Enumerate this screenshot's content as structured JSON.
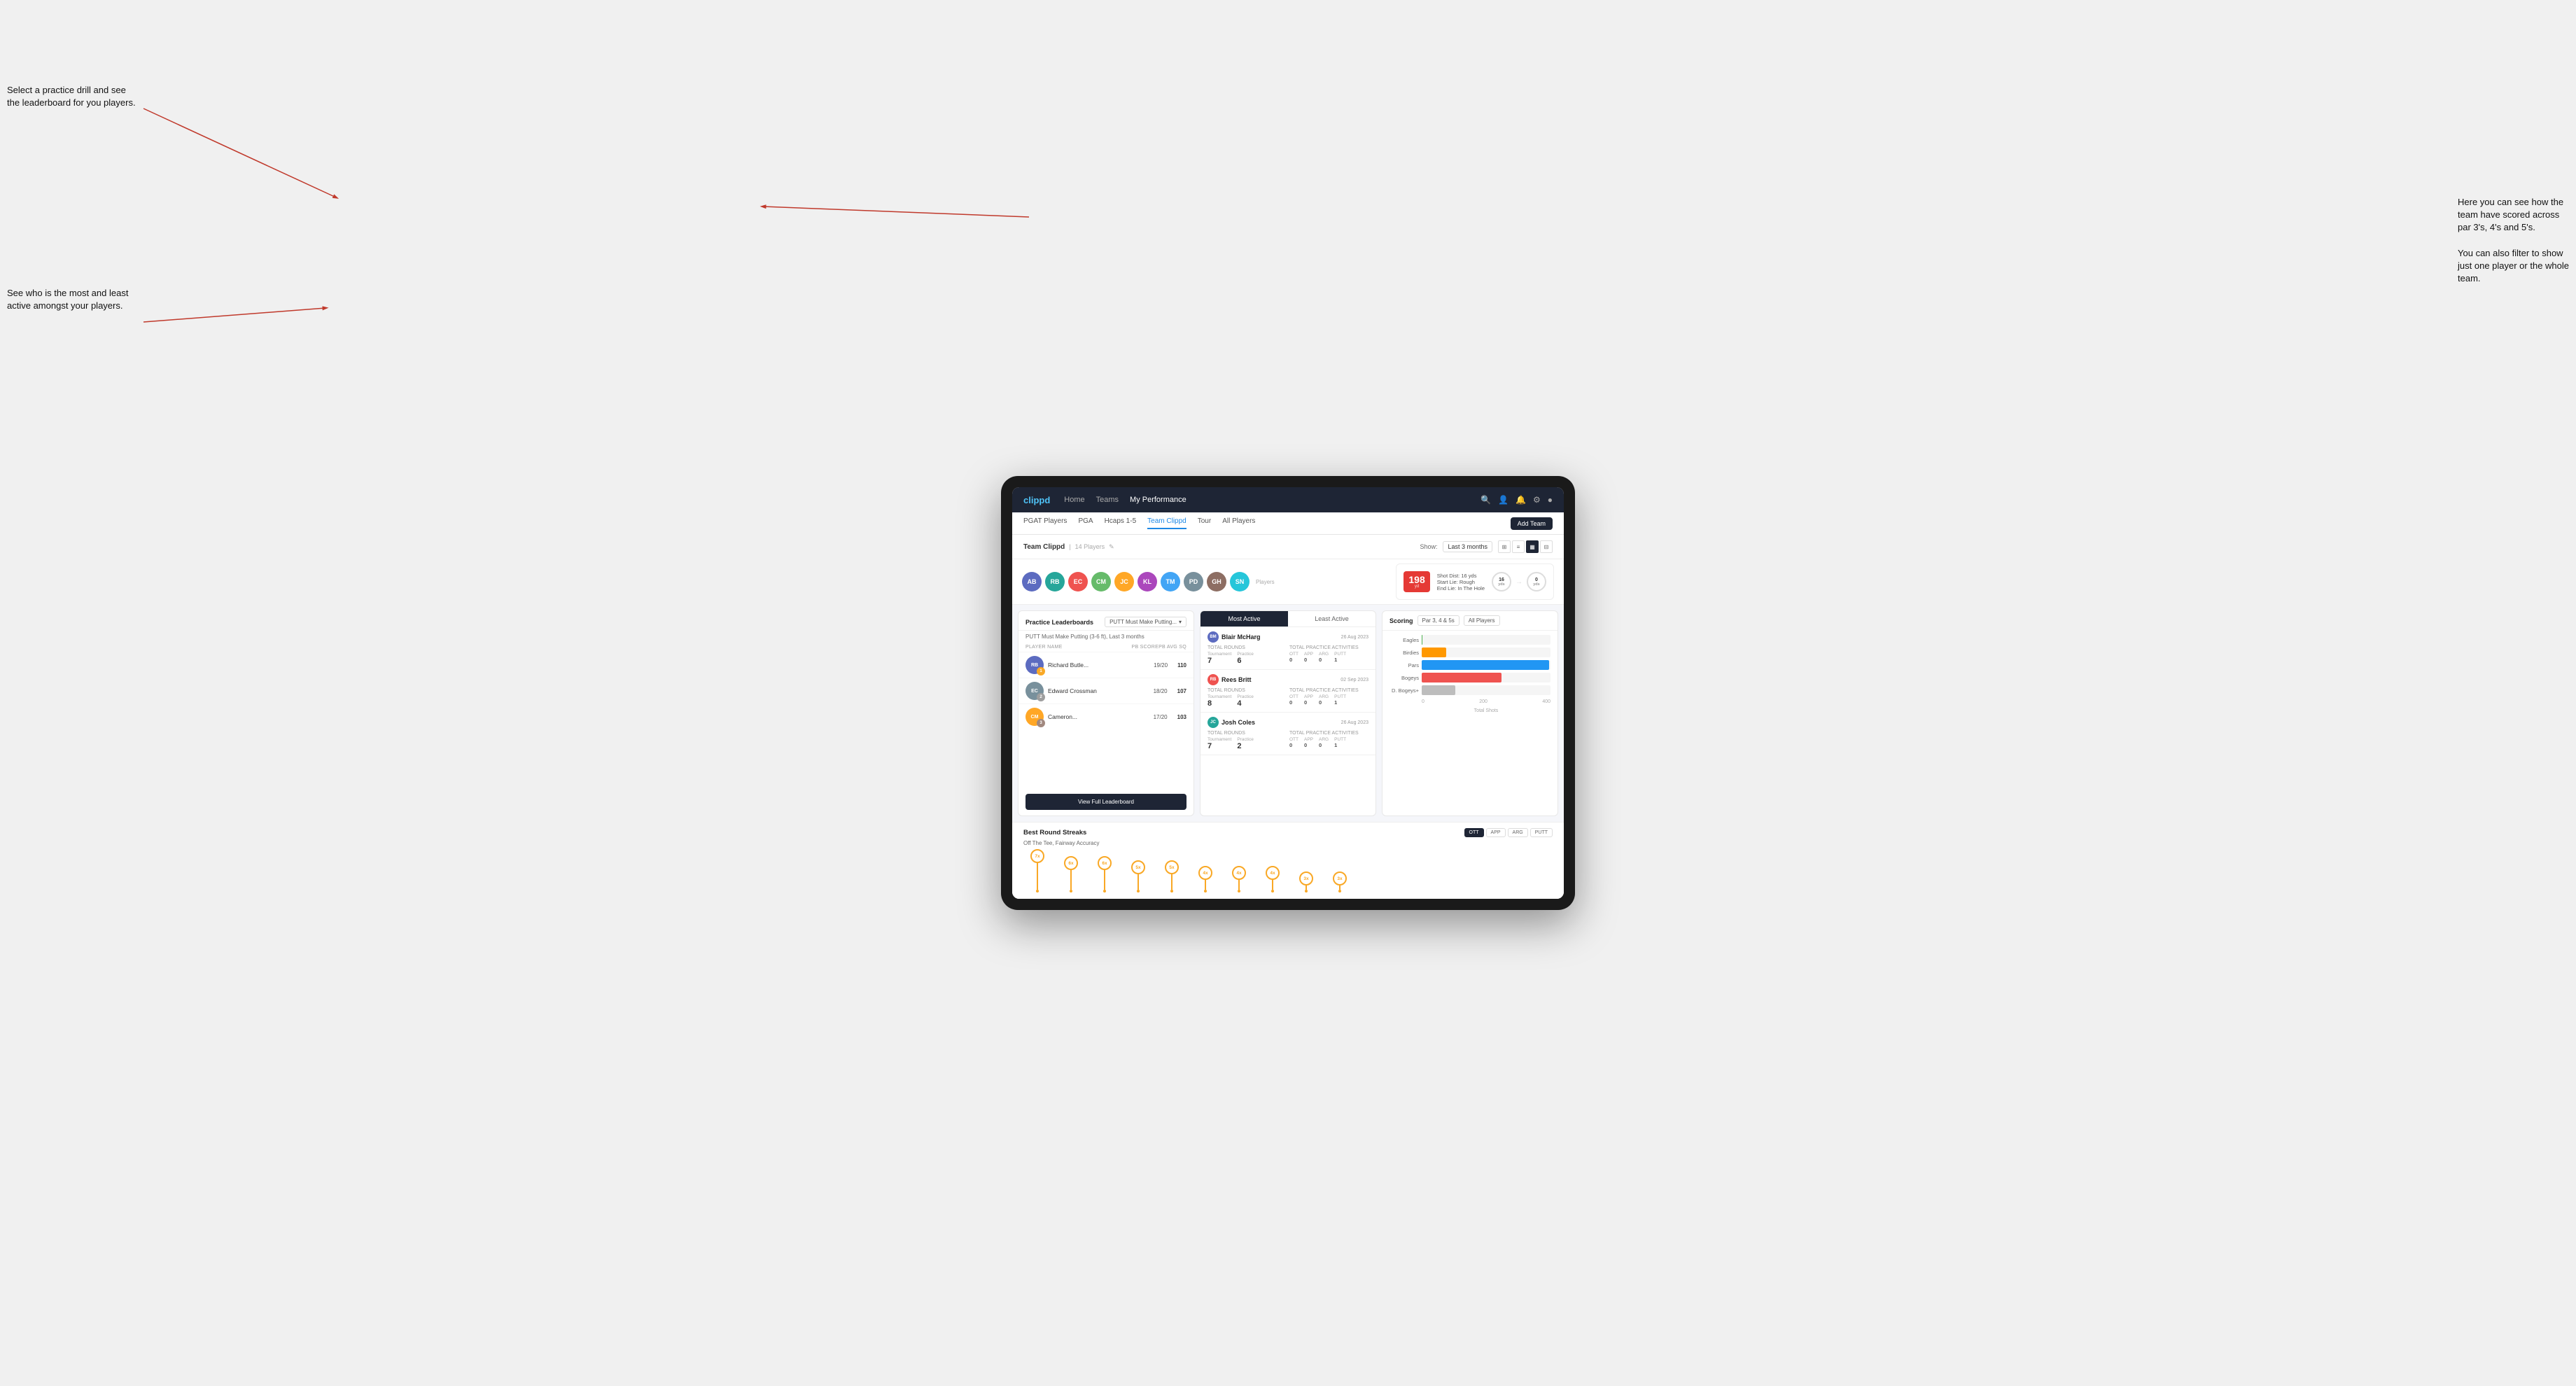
{
  "annotations": {
    "top_left": "Select a practice drill and see\nthe leaderboard for you players.",
    "bottom_left": "See who is the most and least\nactive amongst your players.",
    "top_right_line1": "Here you can see how the",
    "top_right_line2": "team have scored across",
    "top_right_line3": "par 3's, 4's and 5's.",
    "top_right_line4": "",
    "top_right_line5": "You can also filter to show",
    "top_right_line6": "just one player or the whole",
    "top_right_line7": "team."
  },
  "navbar": {
    "logo": "clippd",
    "links": [
      "Home",
      "Teams",
      "My Performance"
    ],
    "active_link": "My Performance"
  },
  "subnav": {
    "links": [
      "PGAT Players",
      "PGA",
      "Hcaps 1-5",
      "Team Clippd",
      "Tour",
      "All Players"
    ],
    "active_link": "Team Clippd",
    "add_team_label": "Add Team"
  },
  "team_header": {
    "title": "Team Clippd",
    "count": "14 Players",
    "show_label": "Show:",
    "period": "Last 3 months"
  },
  "shot_info": {
    "distance": "198",
    "unit": "yd",
    "start_lie": "Start Lie: Rough",
    "end_lie": "End Lie: In The Hole",
    "shot_dist": "Shot Dist: 16 yds",
    "yds1": "16",
    "yds2": "0",
    "yds_label": "yds"
  },
  "practice_leaderboard": {
    "title": "Practice Leaderboards",
    "drill": "PUTT Must Make Putting...",
    "subtitle": "PUTT Must Make Putting (3-6 ft), Last 3 months",
    "headers": [
      "PLAYER NAME",
      "PB SCORE",
      "PB AVG SQ"
    ],
    "rows": [
      {
        "name": "Richard Butle...",
        "score": "19/20",
        "avg": "110",
        "rank": 1,
        "badge": "gold",
        "initials": "RB"
      },
      {
        "name": "Edward Crossman",
        "score": "18/20",
        "avg": "107",
        "rank": 2,
        "badge": "silver",
        "initials": "EC"
      },
      {
        "name": "Cameron...",
        "score": "17/20",
        "avg": "103",
        "rank": 3,
        "badge": "bronze",
        "initials": "CM"
      }
    ],
    "view_full_label": "View Full Leaderboard"
  },
  "activity": {
    "tabs": [
      "Most Active",
      "Least Active"
    ],
    "active_tab": "Most Active",
    "players": [
      {
        "name": "Blair McHarg",
        "date": "26 Aug 2023",
        "total_rounds_label": "Total Rounds",
        "tournament": "7",
        "tournament_label": "Tournament",
        "practice": "6",
        "practice_label": "Practice",
        "total_practice_label": "Total Practice Activities",
        "ott": "0",
        "app": "0",
        "arg": "0",
        "putt": "1",
        "initials": "BM",
        "color": "#5c6bc0"
      },
      {
        "name": "Rees Britt",
        "date": "02 Sep 2023",
        "total_rounds_label": "Total Rounds",
        "tournament": "8",
        "tournament_label": "Tournament",
        "practice": "4",
        "practice_label": "Practice",
        "total_practice_label": "Total Practice Activities",
        "ott": "0",
        "app": "0",
        "arg": "0",
        "putt": "1",
        "initials": "RB",
        "color": "#ef5350"
      },
      {
        "name": "Josh Coles",
        "date": "26 Aug 2023",
        "total_rounds_label": "Total Rounds",
        "tournament": "7",
        "tournament_label": "Tournament",
        "practice": "2",
        "practice_label": "Practice",
        "total_practice_label": "Total Practice Activities",
        "ott": "0",
        "app": "0",
        "arg": "0",
        "putt": "1",
        "initials": "JC",
        "color": "#26a69a"
      }
    ]
  },
  "scoring": {
    "title": "Scoring",
    "filter1": "Par 3, 4 & 5s",
    "filter2": "All Players",
    "bars": [
      {
        "label": "Eagles",
        "value": 3,
        "max": 400,
        "pct": 0.75,
        "color": "#4caf50"
      },
      {
        "label": "Birdies",
        "value": 96,
        "max": 400,
        "pct": 24,
        "color": "#ff9800"
      },
      {
        "label": "Pars",
        "value": 499,
        "max": 500,
        "pct": 99.8,
        "color": "#2196f3"
      },
      {
        "label": "Bogeys",
        "value": 311,
        "max": 500,
        "pct": 62.2,
        "color": "#ef5350"
      },
      {
        "label": "D. Bogeys+",
        "value": 131,
        "max": 500,
        "pct": 26.2,
        "color": "#bdbdbd"
      }
    ],
    "axis_labels": [
      "0",
      "200",
      "400"
    ],
    "axis_title": "Total Shots"
  },
  "streaks": {
    "title": "Best Round Streaks",
    "subtitle": "Off The Tee, Fairway Accuracy",
    "buttons": [
      "OTT",
      "APP",
      "ARG",
      "PUTT"
    ],
    "active_btn": "OTT",
    "pins": [
      {
        "label": "7x",
        "height": 55
      },
      {
        "label": "6x",
        "height": 44
      },
      {
        "label": "6x",
        "height": 44
      },
      {
        "label": "5x",
        "height": 36
      },
      {
        "label": "5x",
        "height": 36
      },
      {
        "label": "4x",
        "height": 28
      },
      {
        "label": "4x",
        "height": 28
      },
      {
        "label": "4x",
        "height": 28
      },
      {
        "label": "3x",
        "height": 20
      },
      {
        "label": "3x",
        "height": 20
      }
    ]
  },
  "players": [
    {
      "initials": "AB",
      "color": "#5c6bc0"
    },
    {
      "initials": "RB",
      "color": "#ef5350"
    },
    {
      "initials": "EC",
      "color": "#26a69a"
    },
    {
      "initials": "CM",
      "color": "#ffa726"
    },
    {
      "initials": "JC",
      "color": "#42a5f5"
    },
    {
      "initials": "KL",
      "color": "#ab47bc"
    },
    {
      "initials": "TM",
      "color": "#66bb6a"
    },
    {
      "initials": "PD",
      "color": "#78909c"
    },
    {
      "initials": "GH",
      "color": "#8d6e63"
    },
    {
      "initials": "SN",
      "color": "#26c6da"
    }
  ]
}
